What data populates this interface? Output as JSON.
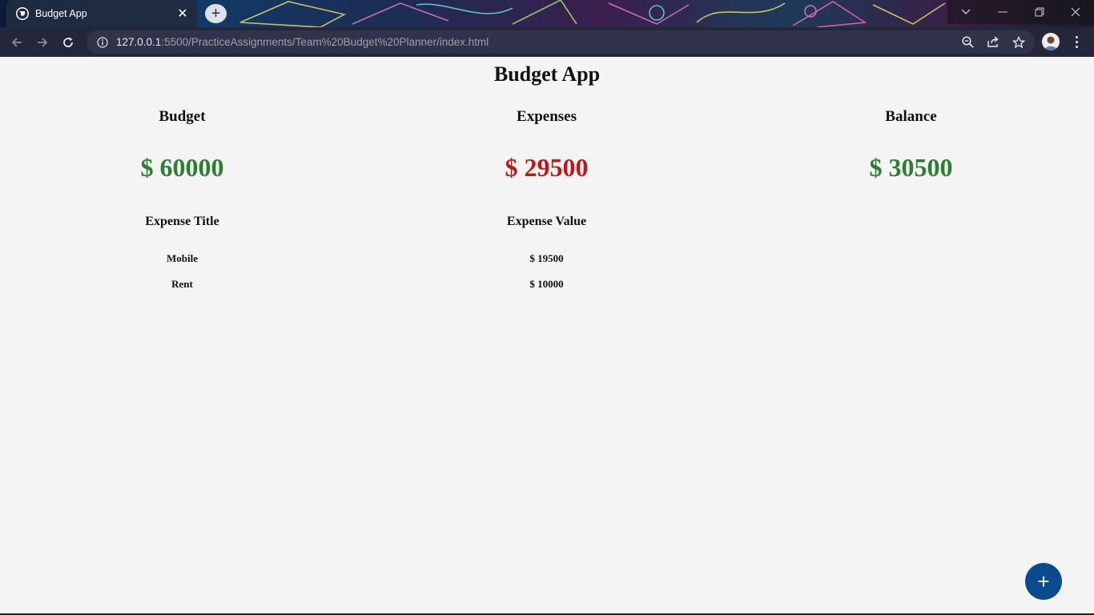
{
  "browser": {
    "tab_title": "Budget App",
    "close_glyph": "✕",
    "new_tab_glyph": "+",
    "url_host": "127.0.0.1",
    "url_rest": ":5500/PracticeAssignments/Team%20Budget%20Planner/index.html",
    "icons": [
      "back-icon",
      "forward-icon",
      "reload-icon",
      "info-icon",
      "zoom-icon",
      "share-icon",
      "star-icon",
      "profile-avatar",
      "menu-icon"
    ]
  },
  "app": {
    "title": "Budget App",
    "budget": {
      "label": "Budget",
      "value": "$ 60000",
      "color": "#2e7d32"
    },
    "expenses": {
      "label": "Expenses",
      "value": "$ 29500",
      "color": "#b71c1c"
    },
    "balance": {
      "label": "Balance",
      "value": "$ 30500",
      "color": "#2e7d32"
    },
    "table": {
      "headers": [
        "Expense Title",
        "Expense Value"
      ],
      "rows": [
        {
          "title": "Mobile",
          "value": "$ 19500"
        },
        {
          "title": "Rent",
          "value": "$ 10000"
        }
      ]
    },
    "fab_label": "+",
    "fab_color": "#0a4a8f"
  }
}
